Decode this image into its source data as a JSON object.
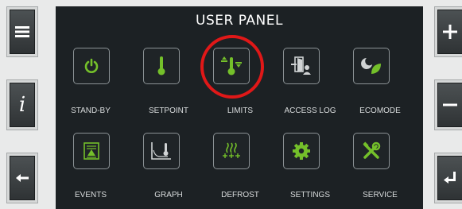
{
  "panel": {
    "title": "USER PANEL",
    "items": [
      {
        "label": "STAND-BY",
        "icon": "power-icon"
      },
      {
        "label": "SETPOINT",
        "icon": "thermometer-icon"
      },
      {
        "label": "LIMITS",
        "icon": "temperature-limits-icon"
      },
      {
        "label": "ACCESS LOG",
        "icon": "door-user-icon"
      },
      {
        "label": "ECOMODE",
        "icon": "moon-leaf-icon"
      },
      {
        "label": "EVENTS",
        "icon": "alarm-list-icon"
      },
      {
        "label": "GRAPH",
        "icon": "temperature-graph-icon"
      },
      {
        "label": "DEFROST",
        "icon": "defrost-icon"
      },
      {
        "label": "SETTINGS",
        "icon": "gear-icon"
      },
      {
        "label": "SERVICE",
        "icon": "tools-icon"
      }
    ]
  },
  "side_buttons": {
    "left": [
      "menu-icon",
      "info-icon",
      "back-arrow-icon"
    ],
    "right": [
      "plus-icon",
      "minus-icon",
      "enter-icon"
    ]
  },
  "colors": {
    "accent": "#74c02a",
    "panel_bg": "#1c2124",
    "highlight": "#e01818",
    "screen_bg": "#e9eaea"
  },
  "selected_item": "LIMITS"
}
